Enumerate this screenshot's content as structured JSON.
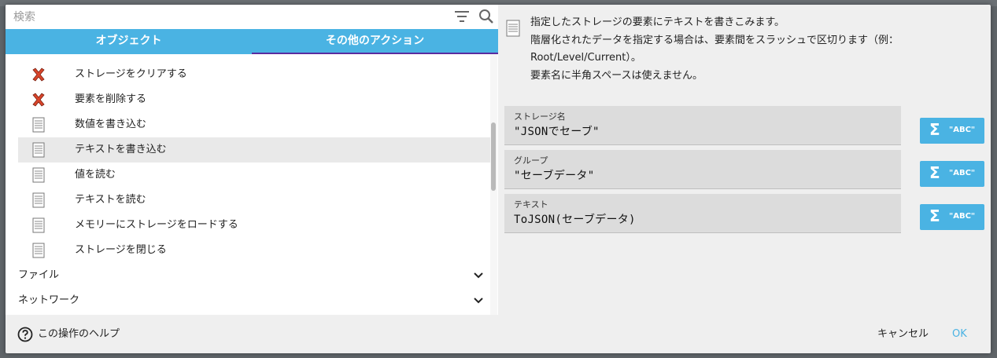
{
  "search": {
    "placeholder": "検索"
  },
  "tabs": [
    {
      "label": "オブジェクト"
    },
    {
      "label": "その他のアクション"
    }
  ],
  "actions": [
    {
      "label": "ストレージをクリアする",
      "icon": "red-x-icon"
    },
    {
      "label": "要素を削除する",
      "icon": "red-x-icon"
    },
    {
      "label": "数値を書き込む",
      "icon": "document-icon"
    },
    {
      "label": "テキストを書き込む",
      "icon": "document-icon",
      "selected": true
    },
    {
      "label": "値を読む",
      "icon": "document-icon"
    },
    {
      "label": "テキストを読む",
      "icon": "document-icon"
    },
    {
      "label": "メモリーにストレージをロードする",
      "icon": "document-icon"
    },
    {
      "label": "ストレージを閉じる",
      "icon": "document-icon"
    }
  ],
  "categories": [
    {
      "label": "ファイル"
    },
    {
      "label": "ネットワーク"
    }
  ],
  "description": {
    "line1": "指定したストレージの要素にテキストを書きこみます。",
    "line2": "階層化されたデータを指定する場合は、要素間をスラッシュで区切ります（例：",
    "line3": "Root/Level/Current）。",
    "line4": "要素名に半角スペースは使えません。"
  },
  "fields": [
    {
      "label": "ストレージ名",
      "value": "\"JSONでセーブ\""
    },
    {
      "label": "グループ",
      "value": "\"セーブデータ\""
    },
    {
      "label": "テキスト",
      "value": "ToJSON(セーブデータ)"
    }
  ],
  "expression_button": {
    "sigma": "Σ",
    "label": "\"ABC\""
  },
  "footer": {
    "help": "この操作のヘルプ",
    "cancel": "キャンセル",
    "ok": "OK"
  },
  "colors": {
    "accent": "#4ab3e3",
    "tab_underline": "#5a2ca0",
    "selected_row": "#e9e9e9"
  }
}
